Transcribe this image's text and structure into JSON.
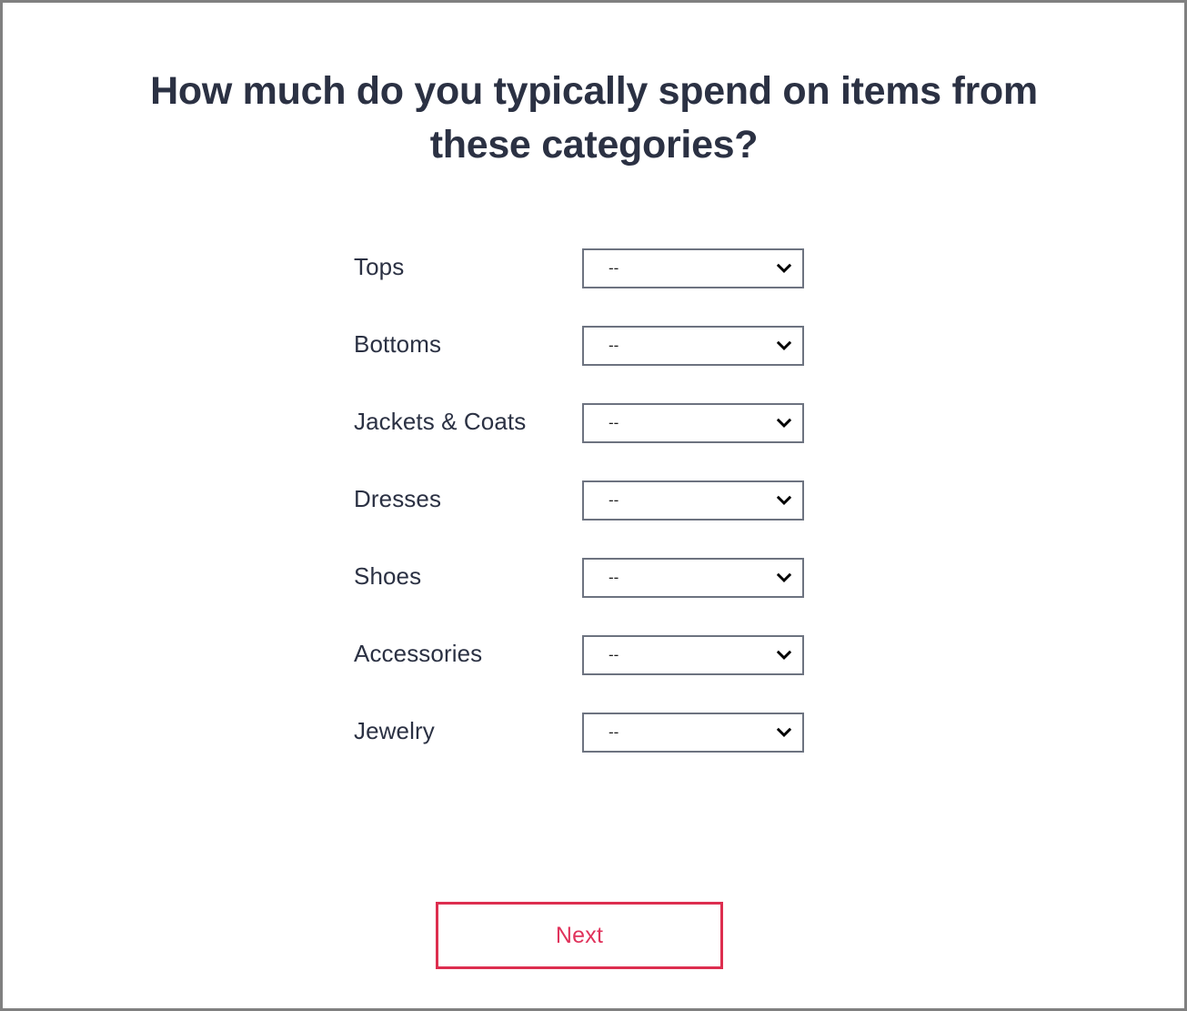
{
  "page": {
    "title": "How much do you typically spend on items from these categories?",
    "background_color": "#ffffff",
    "border_color": "#808080",
    "text_color": "#2b3143",
    "accent_color": "#dd2e4f"
  },
  "form": {
    "rows": [
      {
        "label": "Tops",
        "selected": "--",
        "options": [
          "--"
        ]
      },
      {
        "label": "Bottoms",
        "selected": "--",
        "options": [
          "--"
        ]
      },
      {
        "label": "Jackets & Coats",
        "selected": "--",
        "options": [
          "--"
        ]
      },
      {
        "label": "Dresses",
        "selected": "--",
        "options": [
          "--"
        ]
      },
      {
        "label": "Shoes",
        "selected": "--",
        "options": [
          "--"
        ]
      },
      {
        "label": "Accessories",
        "selected": "--",
        "options": [
          "--"
        ]
      },
      {
        "label": "Jewelry",
        "selected": "--",
        "options": [
          "--"
        ]
      }
    ],
    "dropdown_icon": "chevron-down-icon"
  },
  "footer": {
    "next_label": "Next"
  }
}
